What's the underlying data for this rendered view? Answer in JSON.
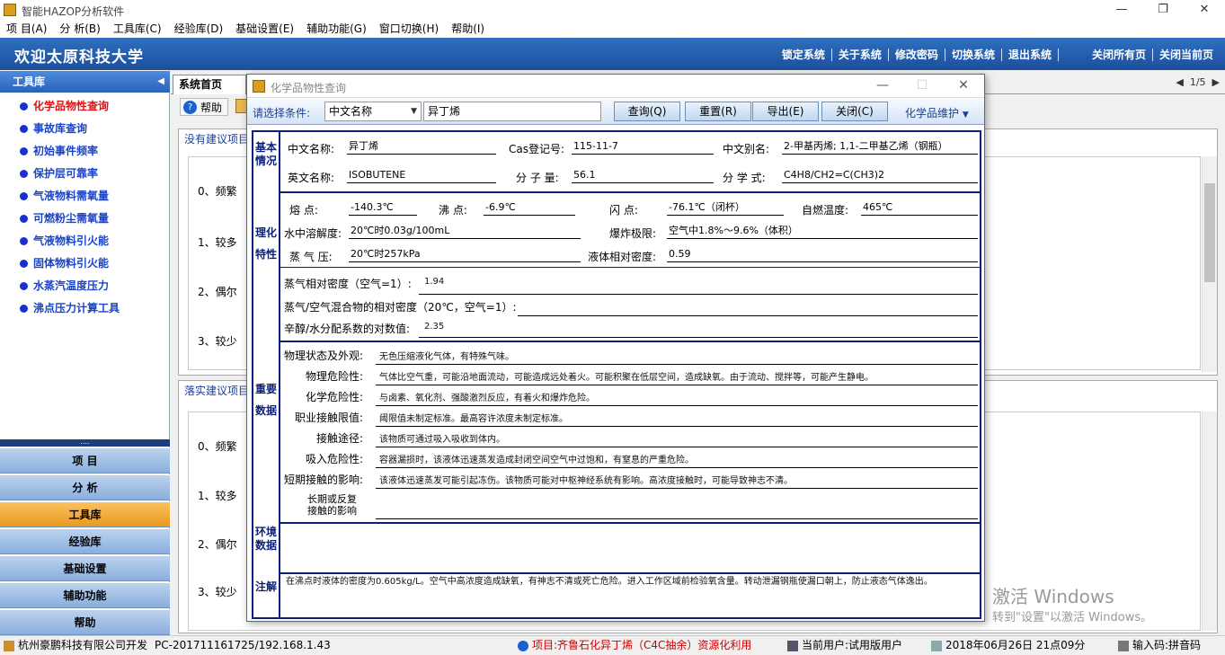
{
  "app": {
    "title": "智能HAZOP分析软件",
    "window_controls": {
      "min": "—",
      "max": "❐",
      "close": "✕"
    }
  },
  "menu": [
    "项 目(A)",
    "分 析(B)",
    "工具库(C)",
    "经验库(D)",
    "基础设置(E)",
    "辅助功能(G)",
    "窗口切换(H)",
    "帮助(I)"
  ],
  "banner": {
    "welcome": "欢迎太原科技大学",
    "links": [
      "锁定系统",
      "关于系统",
      "修改密码",
      "切换系统",
      "退出系统"
    ],
    "right_links": [
      "关闭所有页",
      "关闭当前页"
    ]
  },
  "sidebar": {
    "header": "工具库",
    "items": [
      "化学品物性查询",
      "事故库查询",
      "初始事件频率",
      "保护层可靠率",
      "气液物料需氧量",
      "可燃粉尘需氧量",
      "气液物料引火能",
      "固体物料引火能",
      "水蒸汽温度压力",
      "沸点压力计算工具"
    ],
    "grip": "....",
    "buttons": [
      "项 目",
      "分 析",
      "工具库",
      "经验库",
      "基础设置",
      "辅助功能",
      "帮助"
    ]
  },
  "main": {
    "tab": "系统首页",
    "pager": "1/5",
    "help_label": "帮助",
    "panel1_title": "没有建议项目",
    "panel2_title": "落实建议项目",
    "rows": [
      "0、频繁",
      "1、较多",
      "2、偶尔",
      "3、较少"
    ]
  },
  "dialog": {
    "title": "化学品物性查询",
    "condition_label": "请选择条件:",
    "condition_value": "中文名称",
    "search_value": "异丁烯",
    "buttons": [
      "查询(Q)",
      "重置(R)",
      "导出(E)",
      "关闭(C)"
    ],
    "maintain": "化学品维护",
    "sections": {
      "basic": "基本情况",
      "physchem": "理化特性",
      "important": "重要数据",
      "env": "环境数据",
      "note": "注解"
    },
    "basic": {
      "cn_name_label": "中文名称:",
      "cn_name": "异丁烯",
      "cas_label": "Cas登记号:",
      "cas": "115-11-7",
      "alias_label": "中文别名:",
      "alias": "2-甲基丙烯; 1,1-二甲基乙烯（钢瓶）",
      "en_name_label": "英文名称:",
      "en_name": "ISOBUTENE",
      "mw_label": "分 子 量:",
      "mw": "56.1",
      "formula_label": "分 学 式:",
      "formula": "C4H8/CH2=C(CH3)2"
    },
    "physchem": {
      "mp_label": "熔    点:",
      "mp": "-140.3℃",
      "bp_label": "沸  点:",
      "bp": "-6.9℃",
      "fp_label": "闪    点:",
      "fp": "-76.1℃（闭杯）",
      "ai_label": "自燃温度:",
      "ai": "465℃",
      "sol_label": "水中溶解度:",
      "sol": "20℃时0.03g/100mL",
      "exp_label": "爆炸极限:",
      "exp": "空气中1.8%～9.6%（体积）",
      "vp_label": "蒸 气 压:",
      "vp": "20℃时257kPa",
      "ld_label": "液体相对密度:",
      "ld": "0.59",
      "vd_label": "蒸气相对密度（空气=1）:",
      "vd": "1.94",
      "mix_label": "蒸气/空气混合物的相对密度（20℃，空气=1）:",
      "mix": "",
      "kow_label": "辛醇/水分配系数的对数值:",
      "kow": "2.35"
    },
    "important": [
      {
        "label": "物理状态及外观:",
        "value": "无色压缩液化气体，有特殊气味。"
      },
      {
        "label": "物理危险性:",
        "value": "气体比空气重，可能沿地面流动，可能造成远处着火。可能积聚在低层空间，造成缺氧。由于流动、搅拌等，可能产生静电。"
      },
      {
        "label": "化学危险性:",
        "value": "与卤素、氧化剂、强酸激烈反应，有着火和爆炸危险。"
      },
      {
        "label": "职业接触限值:",
        "value": "阈限值未制定标准。最高容许浓度未制定标准。"
      },
      {
        "label": "接触途径:",
        "value": "该物质可通过吸入吸收到体内。"
      },
      {
        "label": "吸入危险性:",
        "value": "容器漏损时，该液体迅速蒸发造成封闭空间空气中过饱和，有窒息的严重危险。"
      },
      {
        "label": "短期接触的影响:",
        "value": "该液体迅速蒸发可能引起冻伤。该物质可能对中枢神经系统有影响。高浓度接触时，可能导致神志不清。"
      },
      {
        "label": "长期或反复接触的影响",
        "value": ""
      }
    ],
    "note": "在沸点时液体的密度为0.605kg/L。空气中高浓度造成缺氧，有神志不清或死亡危险。进入工作区域前检验氧含量。转动泄漏钢瓶使漏口朝上，防止液态气体逸出。"
  },
  "status": {
    "company": "杭州豪鹏科技有限公司开发",
    "pc": "PC-201711161725/192.168.1.43",
    "project": "项目:齐鲁石化异丁烯（C4C抽余）资源化利用",
    "user": "当前用户:试用版用户",
    "datetime": "2018年06月26日 21点09分",
    "ime": "输入码:拼音码"
  },
  "watermark": {
    "line1": "激活 Windows",
    "line2": "转到\"设置\"以激活 Windows。"
  }
}
